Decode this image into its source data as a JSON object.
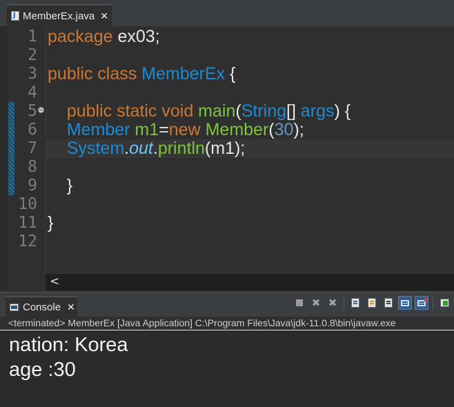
{
  "editor": {
    "tab_label": "MemberEx.java",
    "tab_close": "✕",
    "line_numbers": [
      "1",
      "2",
      "3",
      "4",
      "5",
      "6",
      "7",
      "8",
      "9",
      "10",
      "11",
      "12"
    ],
    "code": {
      "l1_kw": "package",
      "l1_rest": " ex03;",
      "l3_kw": "public class",
      "l3_name": " MemberEx",
      "l3_brace": " {",
      "l5_indent": "    ",
      "l5_kw": "public static void",
      "l5_fn": " main",
      "l5_paren": "(",
      "l5_type": "String",
      "l5_arr": "[] ",
      "l5_args": "args",
      "l5_end": ") {",
      "l6_indent": "    ",
      "l6_type": "Member",
      "l6_var": " m1",
      "l6_eq": "=",
      "l6_new": "new",
      "l6_ctor": " Member",
      "l6_open": "(",
      "l6_num": "30",
      "l6_close": ");",
      "l7_indent": "    ",
      "l7_sys": "System",
      "l7_dot1": ".",
      "l7_out": "out",
      "l7_dot2": ".",
      "l7_fn": "println",
      "l7_args": "(m1);",
      "l9_brace": "    }",
      "l11_brace": "}"
    },
    "scroll_left": "<"
  },
  "console": {
    "tab_label": "Console",
    "tab_close": "✕",
    "status": "<terminated> MemberEx [Java Application] C:\\Program Files\\Java\\jdk-11.0.8\\bin\\javaw.exe",
    "output": [
      "nation: Korea",
      "age :30"
    ],
    "toolbar": {
      "terminate_icon": "stop-icon",
      "remove_icon": "remove-launch-icon",
      "remove_all_icon": "remove-all-icon",
      "x": "✖",
      "xx": "✖"
    }
  },
  "colors": {
    "keyword": "#cc7832",
    "type": "#1c8ad4",
    "method": "#7cc440",
    "number": "#6897bb",
    "static_field": "#6ec4ff",
    "background": "#2b2b2b"
  }
}
